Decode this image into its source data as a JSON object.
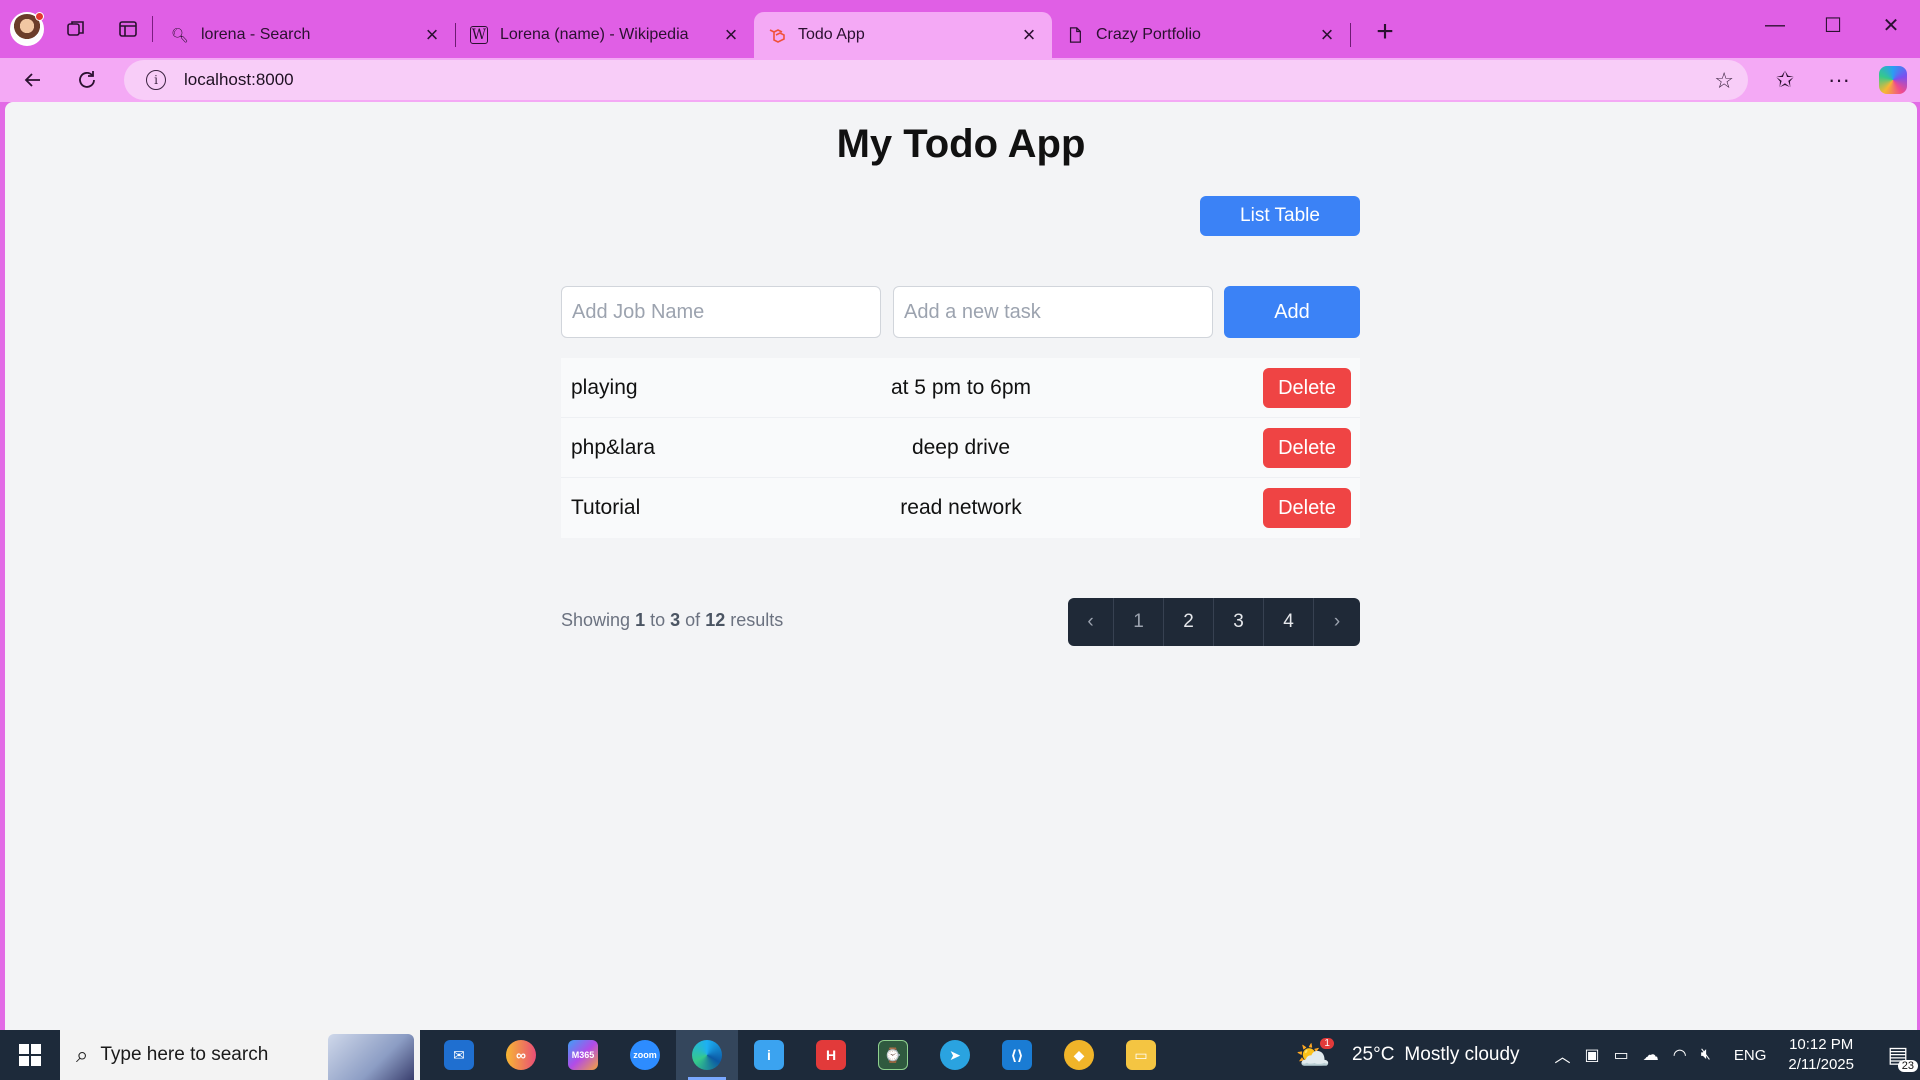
{
  "browser": {
    "tabs": [
      {
        "title": "lorena - Search",
        "favicon": "search-icon",
        "active": false
      },
      {
        "title": "Lorena (name) - Wikipedia",
        "favicon": "wikipedia-icon",
        "active": false
      },
      {
        "title": "Todo App",
        "favicon": "laravel-icon",
        "active": true
      },
      {
        "title": "Crazy Portfolio",
        "favicon": "document-icon",
        "active": false
      }
    ],
    "url": "localhost:8000"
  },
  "page": {
    "title": "My Todo App",
    "list_table_label": "List Table",
    "job_placeholder": "Add Job Name",
    "task_placeholder": "Add a new task",
    "add_label": "Add",
    "delete_label": "Delete",
    "todos": [
      {
        "job": "playing",
        "task": "at 5 pm to 6pm"
      },
      {
        "job": "php&lara",
        "task": "deep drive"
      },
      {
        "job": "Tutorial",
        "task": "read network"
      }
    ],
    "results": {
      "prefix": "Showing",
      "from": "1",
      "to_word": "to",
      "to": "3",
      "of_word": "of",
      "total": "12",
      "suffix": "results"
    },
    "pages": [
      "1",
      "2",
      "3",
      "4"
    ],
    "current_page": "1"
  },
  "taskbar": {
    "search_placeholder": "Type here to search",
    "apps": [
      "mail-icon",
      "meta-icon",
      "m365-icon",
      "zoom-icon",
      "edge-icon",
      "notepad-icon",
      "h-icon",
      "task-manager-icon",
      "telegram-icon",
      "vscode-icon",
      "dino-icon",
      "file-explorer-icon"
    ],
    "zoom_label": "zoom",
    "m365_label": "M365",
    "weather_temp": "25°C",
    "weather_text": "Mostly cloudy",
    "weather_badge": "1",
    "language": "ENG",
    "time": "10:12 PM",
    "date": "2/11/2025",
    "notifications": "23"
  },
  "colors": {
    "accent_blue": "#3b82f6",
    "danger_red": "#ef4444",
    "pager_dark": "#1f2937",
    "browser_chrome": "#e05fe5"
  }
}
